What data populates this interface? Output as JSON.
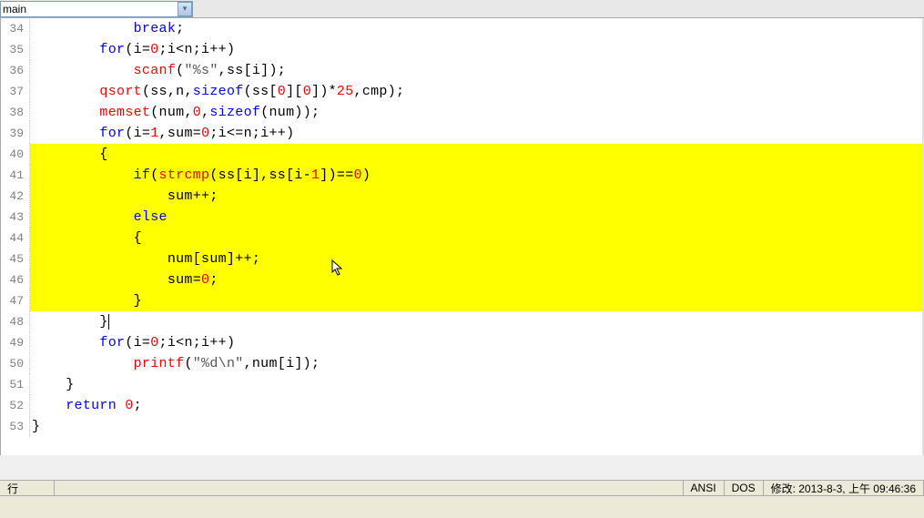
{
  "dropdown": {
    "value": "main"
  },
  "lines": [
    {
      "num": 34,
      "hl": false,
      "tokens": [
        {
          "t": "            ",
          "c": "kw-black"
        },
        {
          "t": "break",
          "c": "kw-blue"
        },
        {
          "t": ";",
          "c": "kw-black"
        }
      ]
    },
    {
      "num": 35,
      "hl": false,
      "tokens": [
        {
          "t": "        ",
          "c": "kw-black"
        },
        {
          "t": "for",
          "c": "kw-blue"
        },
        {
          "t": "(i=",
          "c": "kw-black"
        },
        {
          "t": "0",
          "c": "kw-red"
        },
        {
          "t": ";i<n;i++)",
          "c": "kw-black"
        }
      ]
    },
    {
      "num": 36,
      "hl": false,
      "tokens": [
        {
          "t": "            ",
          "c": "kw-black"
        },
        {
          "t": "scanf",
          "c": "kw-red"
        },
        {
          "t": "(",
          "c": "kw-black"
        },
        {
          "t": "\"%s\"",
          "c": "kw-gray"
        },
        {
          "t": ",ss[i]);",
          "c": "kw-black"
        }
      ]
    },
    {
      "num": 37,
      "hl": false,
      "tokens": [
        {
          "t": "        ",
          "c": "kw-black"
        },
        {
          "t": "qsort",
          "c": "kw-red"
        },
        {
          "t": "(ss,n,",
          "c": "kw-black"
        },
        {
          "t": "sizeof",
          "c": "kw-blue"
        },
        {
          "t": "(ss[",
          "c": "kw-black"
        },
        {
          "t": "0",
          "c": "kw-red"
        },
        {
          "t": "][",
          "c": "kw-black"
        },
        {
          "t": "0",
          "c": "kw-red"
        },
        {
          "t": "])*",
          "c": "kw-black"
        },
        {
          "t": "25",
          "c": "kw-red"
        },
        {
          "t": ",cmp);",
          "c": "kw-black"
        }
      ]
    },
    {
      "num": 38,
      "hl": false,
      "tokens": [
        {
          "t": "        ",
          "c": "kw-black"
        },
        {
          "t": "memset",
          "c": "kw-red"
        },
        {
          "t": "(num,",
          "c": "kw-black"
        },
        {
          "t": "0",
          "c": "kw-red"
        },
        {
          "t": ",",
          "c": "kw-black"
        },
        {
          "t": "sizeof",
          "c": "kw-blue"
        },
        {
          "t": "(num));",
          "c": "kw-black"
        }
      ]
    },
    {
      "num": 39,
      "hl": false,
      "tokens": [
        {
          "t": "        ",
          "c": "kw-black"
        },
        {
          "t": "for",
          "c": "kw-blue"
        },
        {
          "t": "(i=",
          "c": "kw-black"
        },
        {
          "t": "1",
          "c": "kw-red"
        },
        {
          "t": ",sum=",
          "c": "kw-black"
        },
        {
          "t": "0",
          "c": "kw-red"
        },
        {
          "t": ";i<=n;i++)",
          "c": "kw-black"
        }
      ]
    },
    {
      "num": 40,
      "hl": true,
      "tokens": [
        {
          "t": "        {",
          "c": "kw-black"
        }
      ]
    },
    {
      "num": 41,
      "hl": true,
      "tokens": [
        {
          "t": "            ",
          "c": "kw-black"
        },
        {
          "t": "if",
          "c": "kw-blue"
        },
        {
          "t": "(",
          "c": "kw-black"
        },
        {
          "t": "strcmp",
          "c": "kw-red"
        },
        {
          "t": "(ss[i],ss[i-",
          "c": "kw-black"
        },
        {
          "t": "1",
          "c": "kw-red"
        },
        {
          "t": "])==",
          "c": "kw-black"
        },
        {
          "t": "0",
          "c": "kw-red"
        },
        {
          "t": ")",
          "c": "kw-black"
        }
      ]
    },
    {
      "num": 42,
      "hl": true,
      "tokens": [
        {
          "t": "                sum++;",
          "c": "kw-black"
        }
      ]
    },
    {
      "num": 43,
      "hl": true,
      "tokens": [
        {
          "t": "            ",
          "c": "kw-black"
        },
        {
          "t": "else",
          "c": "kw-blue"
        }
      ]
    },
    {
      "num": 44,
      "hl": true,
      "tokens": [
        {
          "t": "            {",
          "c": "kw-black"
        }
      ]
    },
    {
      "num": 45,
      "hl": true,
      "tokens": [
        {
          "t": "                num[sum]++;",
          "c": "kw-black"
        }
      ]
    },
    {
      "num": 46,
      "hl": true,
      "tokens": [
        {
          "t": "                sum=",
          "c": "kw-black"
        },
        {
          "t": "0",
          "c": "kw-red"
        },
        {
          "t": ";",
          "c": "kw-black"
        }
      ]
    },
    {
      "num": 47,
      "hl": true,
      "tokens": [
        {
          "t": "            }",
          "c": "kw-black"
        }
      ]
    },
    {
      "num": 48,
      "hl": false,
      "cursor": true,
      "tokens": [
        {
          "t": "        }",
          "c": "kw-black"
        }
      ]
    },
    {
      "num": 49,
      "hl": false,
      "tokens": [
        {
          "t": "        ",
          "c": "kw-black"
        },
        {
          "t": "for",
          "c": "kw-blue"
        },
        {
          "t": "(i=",
          "c": "kw-black"
        },
        {
          "t": "0",
          "c": "kw-red"
        },
        {
          "t": ";i<n;i++)",
          "c": "kw-black"
        }
      ]
    },
    {
      "num": 50,
      "hl": false,
      "tokens": [
        {
          "t": "            ",
          "c": "kw-black"
        },
        {
          "t": "printf",
          "c": "kw-red"
        },
        {
          "t": "(",
          "c": "kw-black"
        },
        {
          "t": "\"%d\\n\"",
          "c": "kw-gray"
        },
        {
          "t": ",num[i]);",
          "c": "kw-black"
        }
      ]
    },
    {
      "num": 51,
      "hl": false,
      "tokens": [
        {
          "t": "    }",
          "c": "kw-black"
        }
      ]
    },
    {
      "num": 52,
      "hl": false,
      "tokens": [
        {
          "t": "    ",
          "c": "kw-black"
        },
        {
          "t": "return",
          "c": "kw-blue"
        },
        {
          "t": " ",
          "c": "kw-black"
        },
        {
          "t": "0",
          "c": "kw-red"
        },
        {
          "t": ";",
          "c": "kw-black"
        }
      ]
    },
    {
      "num": 53,
      "hl": false,
      "tokens": [
        {
          "t": "}",
          "c": "kw-black"
        }
      ]
    }
  ],
  "statusbar": {
    "rowlabel": "行",
    "encoding": "ANSI",
    "lineend": "DOS",
    "modified": "修改: 2013-8-3, 上午 09:46:36"
  }
}
